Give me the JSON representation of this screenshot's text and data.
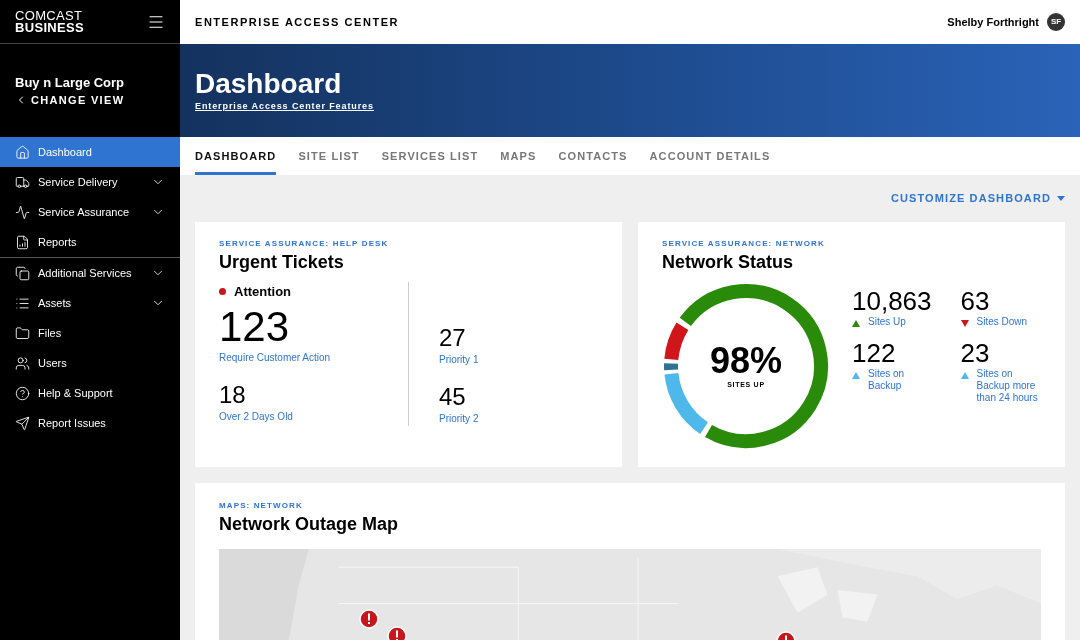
{
  "brand": {
    "line_1": "COMCAST",
    "line_2": "BUSINESS"
  },
  "header": {
    "title": "ENTERPRISE ACCESS CENTER",
    "user": "Shelby Forthright",
    "initials": "SF"
  },
  "account": {
    "name": "Buy n Large Corp",
    "action": "CHANGE VIEW"
  },
  "sidebar": {
    "groups": [
      [
        {
          "label": "Dashboard",
          "selected": true,
          "expandable": false
        },
        {
          "label": "Service Delivery",
          "selected": false,
          "expandable": true
        },
        {
          "label": "Service Assurance",
          "selected": false,
          "expandable": true
        },
        {
          "label": "Reports",
          "selected": false,
          "expandable": false
        }
      ],
      [
        {
          "label": "Additional Services",
          "selected": false,
          "expandable": true
        },
        {
          "label": "Assets",
          "selected": false,
          "expandable": true
        },
        {
          "label": "Files",
          "selected": false,
          "expandable": false
        },
        {
          "label": "Users",
          "selected": false,
          "expandable": false
        },
        {
          "label": "Help & Support",
          "selected": false,
          "expandable": false
        },
        {
          "label": "Report Issues",
          "selected": false,
          "expandable": false
        }
      ]
    ]
  },
  "banner": {
    "title": "Dashboard",
    "subtitle": "Enterprise Access Center Features"
  },
  "tabs": [
    {
      "label": "DASHBOARD",
      "selected": true
    },
    {
      "label": "SITE LIST",
      "selected": false
    },
    {
      "label": "SERVICES LIST",
      "selected": false
    },
    {
      "label": "MAPS",
      "selected": false
    },
    {
      "label": "CONTACTS",
      "selected": false
    },
    {
      "label": "ACCOUNT DETAILS",
      "selected": false
    }
  ],
  "customize": "CUSTOMIZE DASHBOARD",
  "urgent_tickets": {
    "eyebrow": "SERVICE ASSURANCE: HELP DESK",
    "title": "Urgent Tickets",
    "status": "Attention",
    "left": [
      {
        "value": "123",
        "label": "Require Customer Action"
      },
      {
        "value": "18",
        "label": "Over 2 Days Old"
      }
    ],
    "right": [
      {
        "value": "27",
        "label": "Priority 1"
      },
      {
        "value": "45",
        "label": "Priority 2"
      }
    ]
  },
  "network_status": {
    "eyebrow": "SERVICE ASSURANCE: NETWORK",
    "title": "Network Status",
    "percent": "98%",
    "percent_label": "SITES UP",
    "stats": [
      {
        "value": "10,863",
        "label": "Sites Up",
        "kind": "up",
        "color": "#2a8a0a"
      },
      {
        "value": "63",
        "label": "Sites Down",
        "kind": "down",
        "color": "#d0161b"
      },
      {
        "value": "122",
        "label": "Sites on Backup",
        "kind": "up",
        "color": "#4fb8ea"
      },
      {
        "value": "23",
        "label": "Sites on Backup more than 24 hours",
        "kind": "up",
        "color": "#4fb8ea"
      }
    ]
  },
  "map": {
    "eyebrow": "MAPS: NETWORK",
    "title": "Network Outage Map",
    "kind": "picture"
  }
}
